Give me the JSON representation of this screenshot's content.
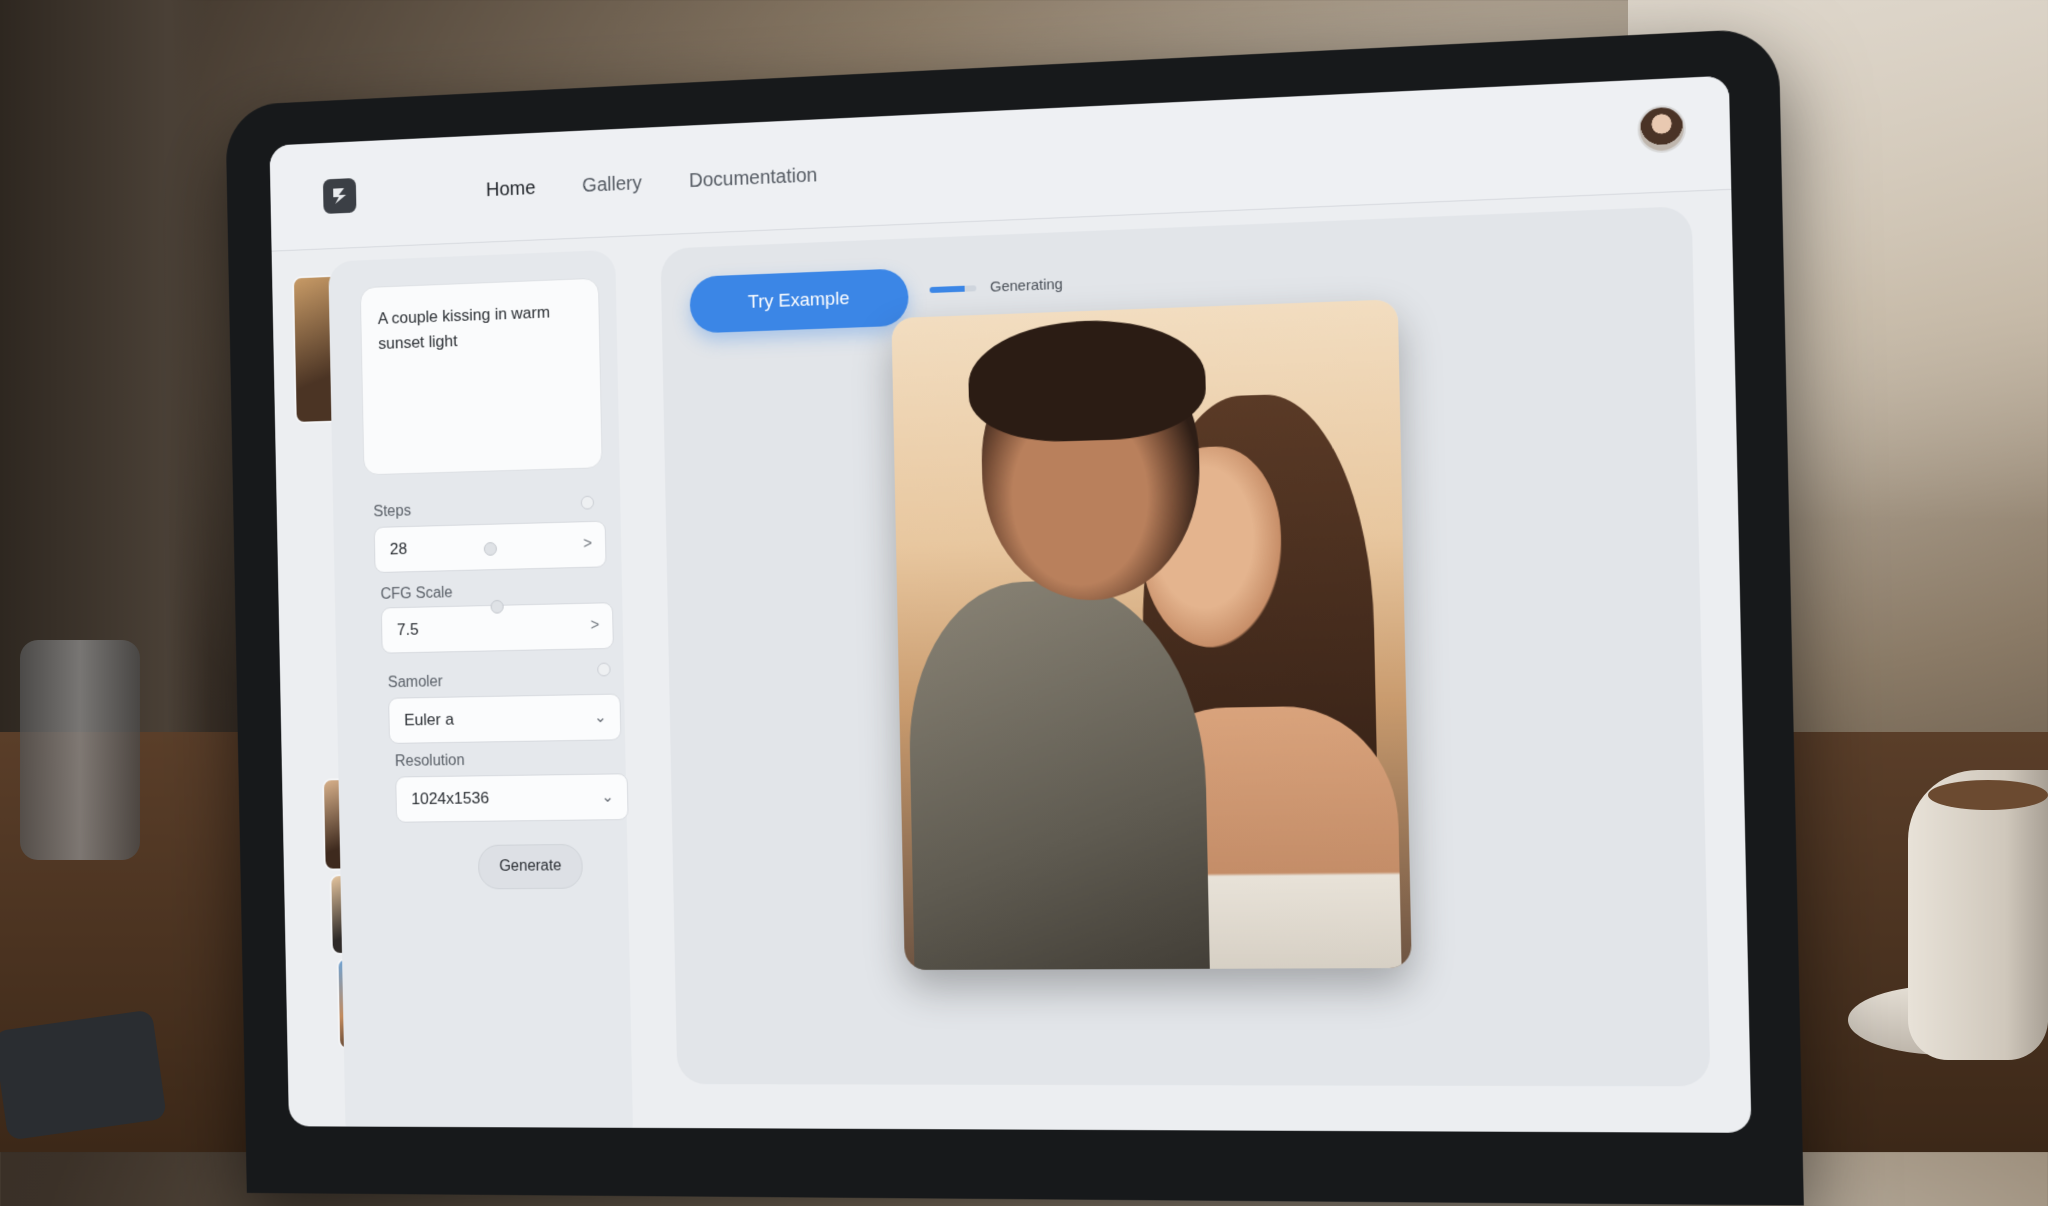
{
  "app": {
    "nav": [
      {
        "label": "Home",
        "active": true
      },
      {
        "label": "Gallery",
        "active": false
      },
      {
        "label": "Documentation",
        "active": false
      }
    ]
  },
  "controls": {
    "prompt_text": "A couple kissing in warm sunset light",
    "steps": {
      "label": "Steps",
      "value": "28"
    },
    "cfg": {
      "label": "CFG Scale",
      "value": "7.5"
    },
    "sampler": {
      "label": "Samoler",
      "value": "Euler a"
    },
    "resolution": {
      "label": "Resolution",
      "value": "1024x1536"
    },
    "generate_label": "Generate"
  },
  "main": {
    "try_example_label": "Try Example",
    "status_text": "Generating",
    "progress": 0.75,
    "accent_color": "#3b86e6"
  },
  "icons": {
    "logo": "app-logo-icon",
    "avatar": "user-avatar",
    "chevron_right": ">",
    "chevron_down": "⌄"
  }
}
